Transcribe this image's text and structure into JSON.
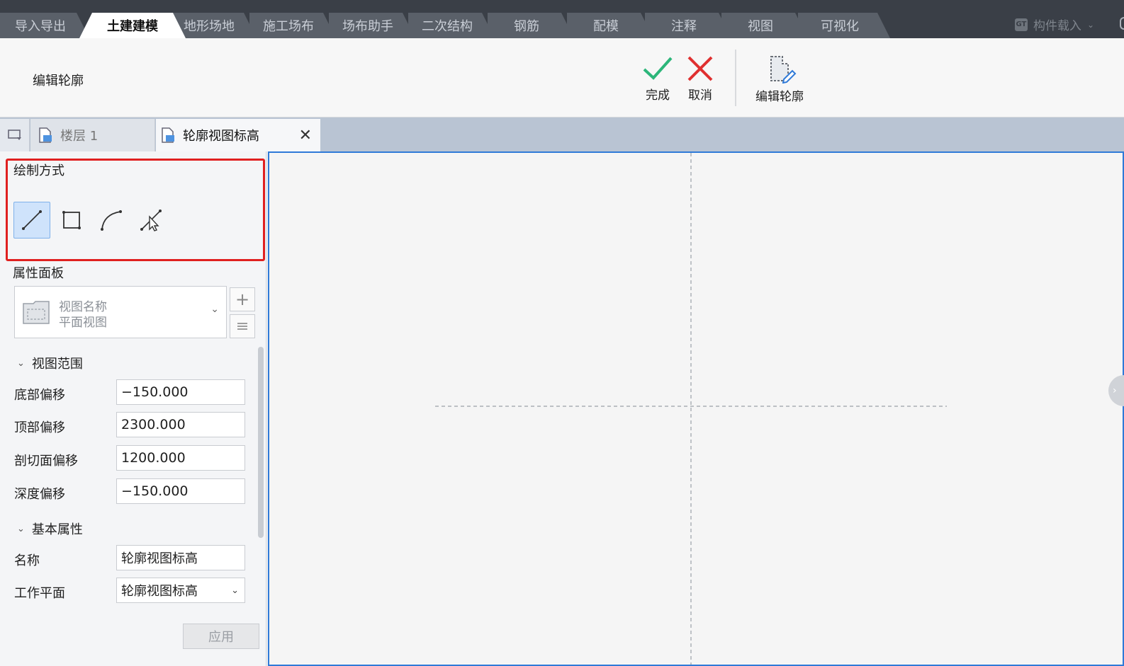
{
  "ribbon": {
    "tabs": [
      "导入导出",
      "土建建模",
      "地形场地",
      "施工场布",
      "场布助手",
      "二次结构",
      "钢筋",
      "配模",
      "注释",
      "视图",
      "可视化"
    ],
    "component_load": "构件载入"
  },
  "toolbar": {
    "title": "编辑轮廓",
    "done": "完成",
    "cancel": "取消",
    "edit_profile": "编辑轮廓"
  },
  "doc_tabs": {
    "floor": "楼层 1",
    "active": "轮廓视图标高"
  },
  "left_panel": {
    "draw_mode_label": "绘制方式",
    "properties_label": "属性面板",
    "view_selector": {
      "line1": "视图名称",
      "line2": "平面视图"
    },
    "group_view_range": "视图范围",
    "fields_view_range": [
      {
        "label": "底部偏移",
        "value": "−150.000"
      },
      {
        "label": "顶部偏移",
        "value": "2300.000"
      },
      {
        "label": "剖切面偏移",
        "value": "1200.000"
      },
      {
        "label": "深度偏移",
        "value": "−150.000"
      }
    ],
    "group_basic": "基本属性",
    "name_label": "名称",
    "name_value": "轮廓视图标高",
    "workplane_label": "工作平面",
    "workplane_value": "轮廓视图标高",
    "apply": "应用"
  },
  "colors": {
    "accent_blue": "#2f7ad8",
    "highlight_red": "#e02020",
    "done_green": "#2cb67a",
    "cancel_red": "#e03030"
  }
}
